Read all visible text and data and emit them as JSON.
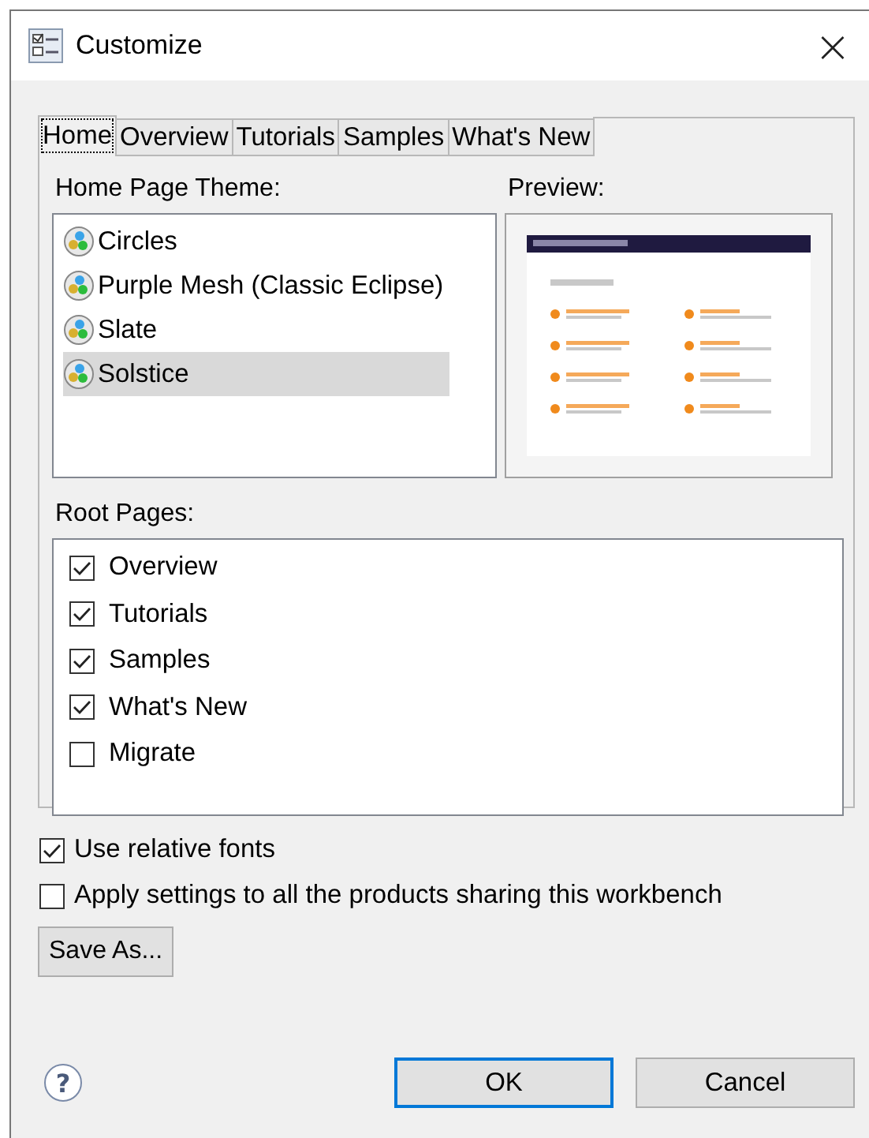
{
  "window": {
    "title": "Customize",
    "close": "×"
  },
  "tabs": [
    {
      "label": "Home",
      "selected": true
    },
    {
      "label": "Overview",
      "selected": false
    },
    {
      "label": "Tutorials",
      "selected": false
    },
    {
      "label": "Samples",
      "selected": false
    },
    {
      "label": "What's New",
      "selected": false
    }
  ],
  "theme": {
    "label": "Home Page Theme:",
    "items": [
      {
        "label": "Circles",
        "selected": false
      },
      {
        "label": "Purple Mesh (Classic Eclipse)",
        "selected": false
      },
      {
        "label": "Slate",
        "selected": false
      },
      {
        "label": "Solstice",
        "selected": true
      }
    ]
  },
  "preview": {
    "label": "Preview:",
    "kind": "picture"
  },
  "root_pages": {
    "label": "Root Pages:",
    "items": [
      {
        "label": "Overview",
        "checked": true
      },
      {
        "label": "Tutorials",
        "checked": true
      },
      {
        "label": "Samples",
        "checked": true
      },
      {
        "label": "What's New",
        "checked": true
      },
      {
        "label": "Migrate",
        "checked": false
      }
    ]
  },
  "options": [
    {
      "label": "Use relative fonts",
      "checked": true
    },
    {
      "label": "Apply settings to all the products sharing this workbench",
      "checked": false
    }
  ],
  "save_as": "Save As...",
  "help": "?",
  "buttons": [
    {
      "label": "OK",
      "default": true
    },
    {
      "label": "Cancel",
      "default": false
    }
  ]
}
